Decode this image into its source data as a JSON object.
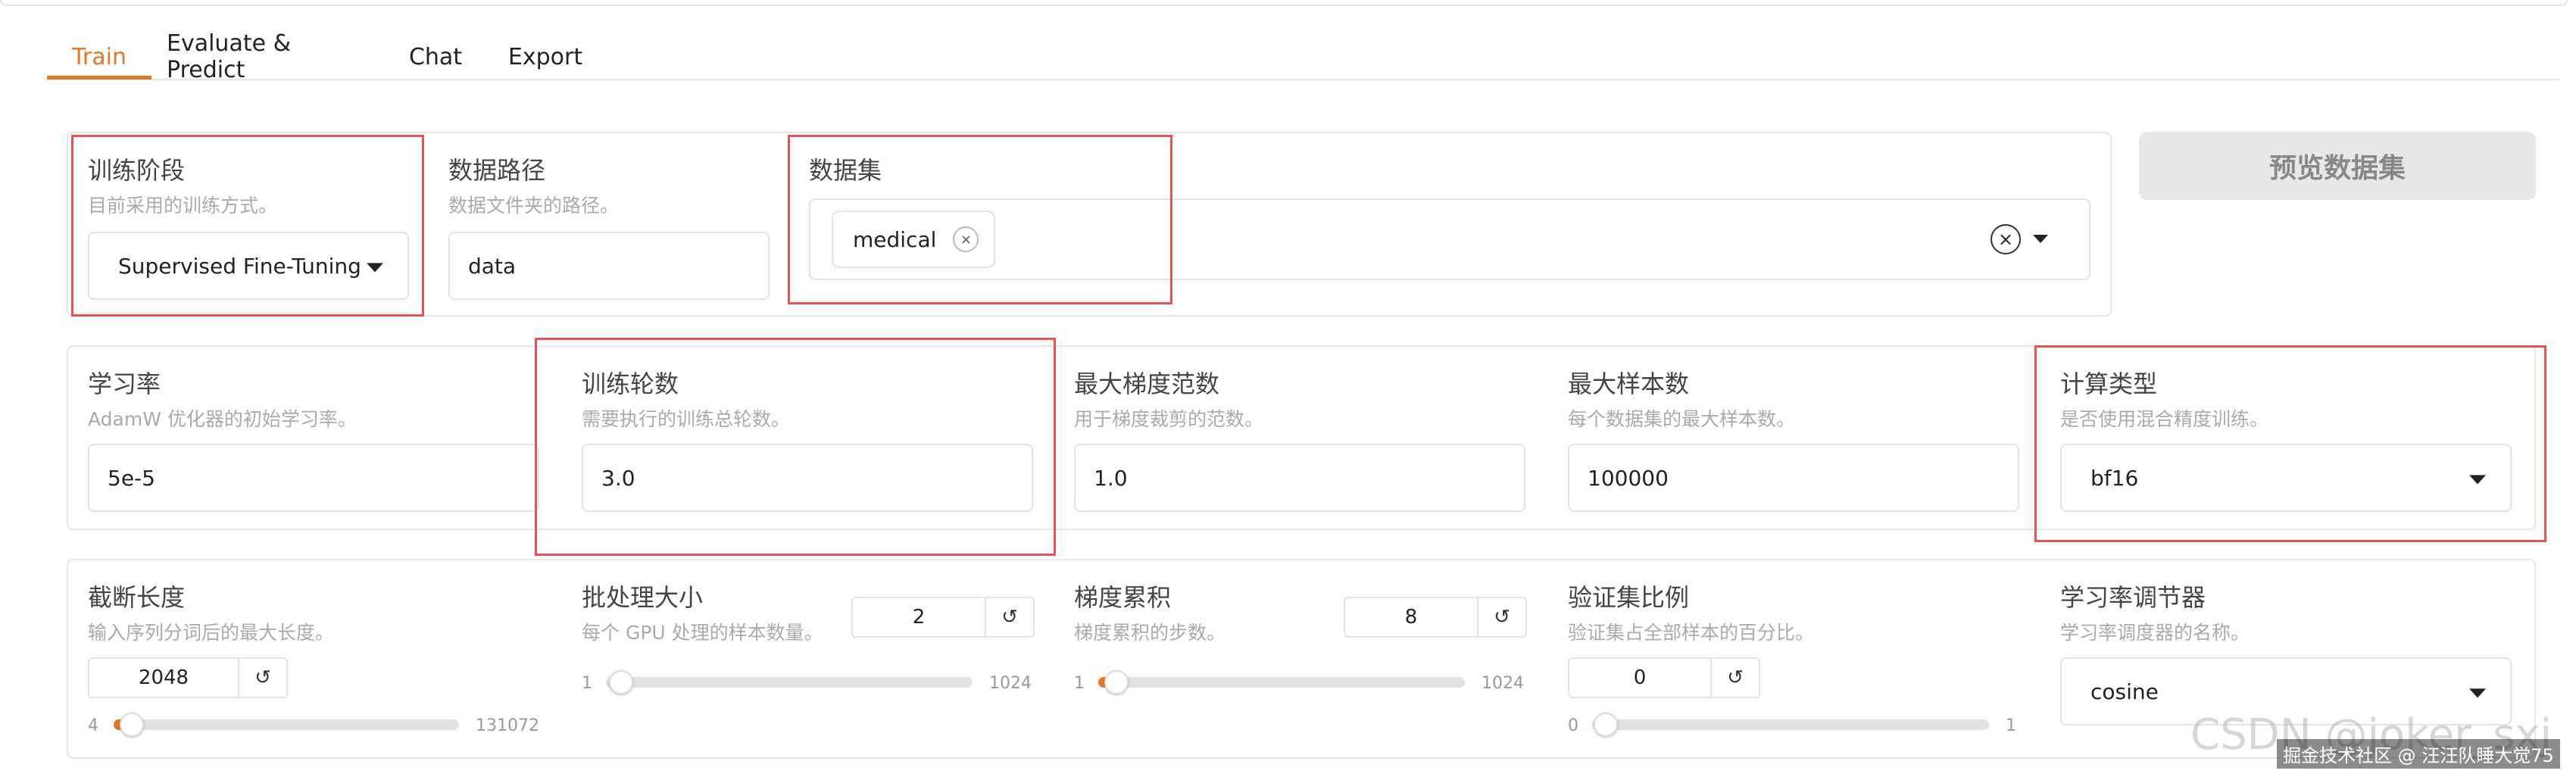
{
  "tabs": [
    "Train",
    "Evaluate & Predict",
    "Chat",
    "Export"
  ],
  "row1": {
    "stage": {
      "label": "训练阶段",
      "hint": "目前采用的训练方式。",
      "value": "Supervised Fine-Tuning"
    },
    "data_path": {
      "label": "数据路径",
      "hint": "数据文件夹的路径。",
      "value": "data"
    },
    "dataset": {
      "label": "数据集",
      "chips": [
        "medical"
      ]
    },
    "preview_button": "预览数据集"
  },
  "row2": {
    "lr": {
      "label": "学习率",
      "hint": "AdamW 优化器的初始学习率。",
      "value": "5e-5"
    },
    "epochs": {
      "label": "训练轮数",
      "hint": "需要执行的训练总轮数。",
      "value": "3.0"
    },
    "max_grad_norm": {
      "label": "最大梯度范数",
      "hint": "用于梯度裁剪的范数。",
      "value": "1.0"
    },
    "max_samples": {
      "label": "最大样本数",
      "hint": "每个数据集的最大样本数。",
      "value": "100000"
    },
    "compute_type": {
      "label": "计算类型",
      "hint": "是否使用混合精度训练。",
      "value": "bf16"
    }
  },
  "row3": {
    "cutoff": {
      "label": "截断长度",
      "hint": "输入序列分词后的最大长度。",
      "value": "2048",
      "min": "4",
      "max": "131072"
    },
    "batch": {
      "label": "批处理大小",
      "hint": "每个 GPU 处理的样本数量。",
      "value": "2",
      "min": "1",
      "max": "1024"
    },
    "grad_accum": {
      "label": "梯度累积",
      "hint": "梯度累积的步数。",
      "value": "8",
      "min": "1",
      "max": "1024"
    },
    "val_size": {
      "label": "验证集比例",
      "hint": "验证集占全部样本的百分比。",
      "value": "0",
      "min": "0",
      "max": "1"
    },
    "scheduler": {
      "label": "学习率调节器",
      "hint": "学习率调度器的名称。",
      "value": "cosine"
    }
  },
  "icons": {
    "reset": "↺",
    "close": "×"
  },
  "watermark": {
    "main": "CSDN @joker_sxj",
    "overlay": "掘金技术社区 @ 汪汪队睡大觉75"
  },
  "colors": {
    "accent": "#e0782a",
    "highlight_box": "#e05555"
  }
}
